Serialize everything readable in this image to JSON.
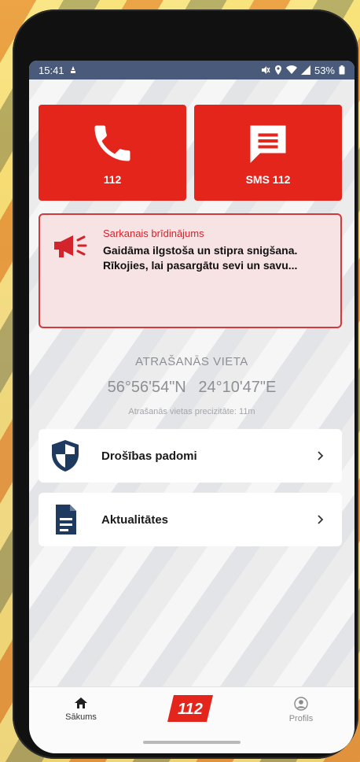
{
  "status_bar": {
    "time": "15:41",
    "battery": "53%"
  },
  "tiles": {
    "call_label": "112",
    "sms_label": "SMS 112"
  },
  "alert": {
    "title": "Sarkanais brīdinājums",
    "line1": "Gaidāma ilgstoša un stipra snigšana.",
    "line2": "Rīkojies, lai pasargātu sevi un savu..."
  },
  "location": {
    "title": "ATRAŠANĀS VIETA",
    "lat": "56°56'54\"N",
    "lon": "24°10'47\"E",
    "precision": "Atrašanās vietas precizitāte: 11m"
  },
  "menu": [
    {
      "label": "Drošības padomi",
      "icon": "shield-icon"
    },
    {
      "label": "Aktualitātes",
      "icon": "document-icon"
    }
  ],
  "nav": {
    "home_label": "Sākums",
    "logo_text": "112",
    "profile_label": "Profils"
  },
  "colors": {
    "accent_red": "#e4251c",
    "navy": "#1f3a5f",
    "alert_bg": "#f7e2e4"
  }
}
